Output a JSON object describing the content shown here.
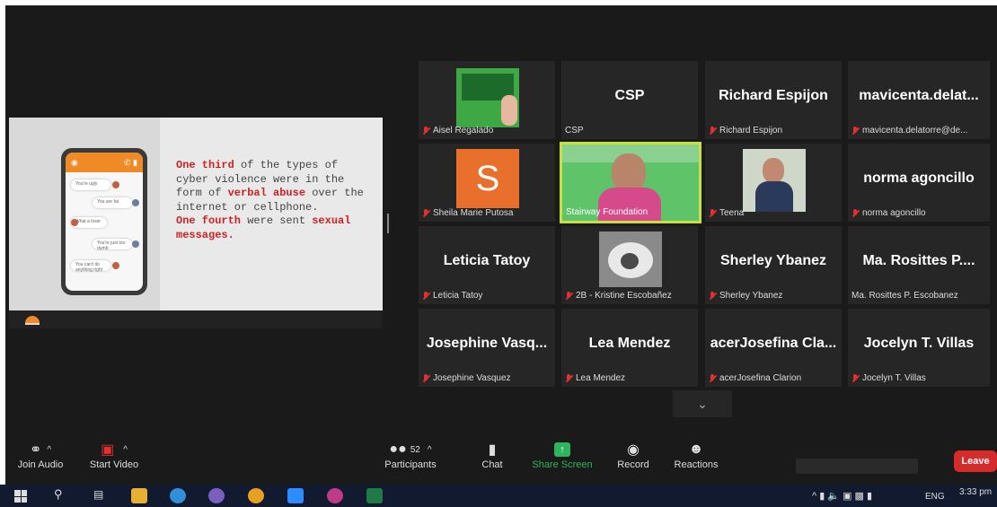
{
  "slide": {
    "t1": "One third",
    "t2": " of the types of cyber violence were in the form of ",
    "t3": "verbal abuse",
    "t4": " over the internet or cellphone.",
    "t5": "One fourth",
    "t6": " were sent ",
    "t7": "sexual messages."
  },
  "tiles": [
    {
      "label": "Aisel Regalado",
      "name": ""
    },
    {
      "label": "CSP",
      "name": "CSP"
    },
    {
      "label": "Richard Espijon",
      "name": "Richard Espijon"
    },
    {
      "label": "mavicenta.delatorre@de...",
      "name": "mavicenta.delat..."
    },
    {
      "label": "Sheila Marie Putosa",
      "initial": "S"
    },
    {
      "label": "Stairway Foundation"
    },
    {
      "label": "Teena"
    },
    {
      "label": "norma agoncillo",
      "name": "norma agoncillo"
    },
    {
      "label": "Leticia Tatoy",
      "name": "Leticia Tatoy"
    },
    {
      "label": "2B - Kristine Escobañez"
    },
    {
      "label": "Sherley Ybanez",
      "name": "Sherley Ybanez"
    },
    {
      "label": "Ma. Rosittes P. Escobanez",
      "name": "Ma.  Rosittes P...."
    },
    {
      "label": "Josephine Vasquez",
      "name": "Josephine  Vasq..."
    },
    {
      "label": "Lea Mendez",
      "name": "Lea Mendez"
    },
    {
      "label": "acerJosefina Clarion",
      "name": "acerJosefina  Cla..."
    },
    {
      "label": "Jocelyn T. Villas",
      "name": "Jocelyn T. Villas"
    }
  ],
  "toolbar": {
    "join_audio": "Join Audio",
    "start_video": "Start Video",
    "participants": "Participants",
    "participants_count": "52",
    "chat": "Chat",
    "share": "Share Screen",
    "record": "Record",
    "reactions": "Reactions",
    "leave": "Leave"
  },
  "taskbar": {
    "lang": "ENG",
    "time": "3:33 pm"
  },
  "colors": {
    "share_green": "#2db55d",
    "leave_red": "#d62b2b",
    "active_speaker": "#c8e03c"
  }
}
